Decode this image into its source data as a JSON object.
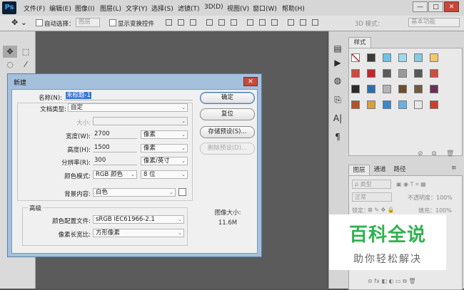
{
  "app": {
    "logo": "Ps"
  },
  "menu": [
    "文件(F)",
    "编辑(E)",
    "图像(I)",
    "图层(L)",
    "文字(Y)",
    "选择(S)",
    "滤镜(T)",
    "3D(D)",
    "视图(V)",
    "窗口(W)",
    "帮助(H)"
  ],
  "window_controls": {
    "minimize": "—",
    "restore": "□",
    "close": "✕"
  },
  "options_bar": {
    "auto_select_label": "自动选择：",
    "auto_select_target": "图层",
    "show_transform_label": "显示变换控件",
    "mode3d_label": "3D 模式：",
    "workspace": "基本功能"
  },
  "tools": [
    "✥",
    "⬚",
    "◌",
    "⁄"
  ],
  "dock_icons": [
    "▤",
    "▶",
    "◍",
    "⎘",
    "A|",
    "¶"
  ],
  "styles_panel": {
    "tab": "样式",
    "swatch_colors": [
      "#ffffff",
      "#3a3a3a",
      "#6cc3e8",
      "#9fd8ec",
      "#88c9e0",
      "#f2c86a",
      "#d04a3a",
      "#c02828",
      "#5a5a5a",
      "#9a9a9a",
      "#585858",
      "#c8503c",
      "#2a2a2a",
      "#2d6fae",
      "#b3b3b3",
      "#6b4f2e",
      "#6e5a3e",
      "#6a2e58",
      "#b2542a",
      "#d4a040",
      "#3d87c6",
      "#6ab0e0",
      "#e6e6e6",
      "#c7402e"
    ]
  },
  "layers_panel": {
    "tabs": [
      "图层",
      "通道",
      "路径"
    ],
    "filter_kind": "ρ 类型",
    "blend_mode": "正常",
    "opacity_label": "不透明度：100%",
    "lock_label": "锁定：",
    "fill_label": "填充：100%"
  },
  "dialog": {
    "title": "新建",
    "close": "✕",
    "fields": {
      "name_label": "名称(N):",
      "name_value": "未标题-1",
      "preset_label": "文档类型:",
      "preset_value": "自定",
      "size_label": "大小:",
      "size_value": "",
      "width_label": "宽度(W):",
      "width_value": "2700",
      "width_unit": "像素",
      "height_label": "高度(H):",
      "height_value": "1500",
      "height_unit": "像素",
      "resolution_label": "分辨率(R):",
      "resolution_value": "300",
      "resolution_unit": "像素/英寸",
      "color_mode_label": "颜色模式:",
      "color_mode_value": "RGB 颜色",
      "bit_depth_value": "8 位",
      "background_label": "背景内容:",
      "background_value": "白色"
    },
    "advanced": {
      "title": "高级",
      "profile_label": "颜色配置文件:",
      "profile_value": "sRGB IEC61966-2.1",
      "aspect_label": "像素长宽比:",
      "aspect_value": "方形像素"
    },
    "buttons": {
      "ok": "确定",
      "reset": "复位",
      "save_preset": "存储预设(S)...",
      "delete_preset": "删除预设(D)..."
    },
    "image_size_label": "图像大小:",
    "image_size_value": "11.6M"
  },
  "watermark": {
    "title": "百科全说",
    "subtitle": "助你轻松解决"
  }
}
